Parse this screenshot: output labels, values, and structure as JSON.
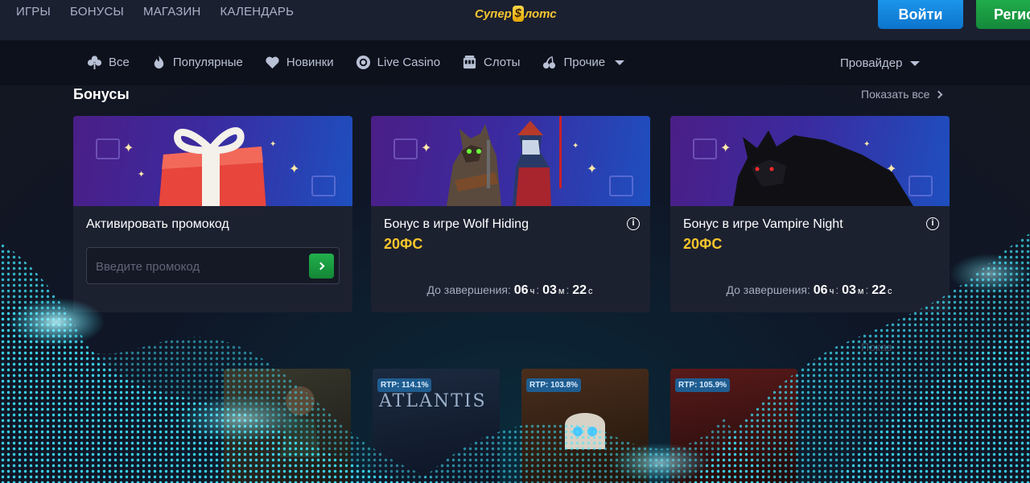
{
  "header": {
    "nav": [
      "ИГРЫ",
      "БОНУСЫ",
      "МАГАЗИН",
      "КАЛЕНДАРЬ"
    ],
    "logo": {
      "left": "Супер",
      "coin": "$",
      "right": "лотс"
    },
    "login_label": "Войти",
    "register_label": "Регис"
  },
  "categories": {
    "items": [
      {
        "label": "Все",
        "icon": "clover-icon"
      },
      {
        "label": "Популярные",
        "icon": "fire-icon"
      },
      {
        "label": "Новинки",
        "icon": "heart-icon"
      },
      {
        "label": "Live Casino",
        "icon": "chip-icon"
      },
      {
        "label": "Слоты",
        "icon": "slot-machine-icon"
      },
      {
        "label": "Прочие",
        "icon": "cherries-icon"
      }
    ],
    "provider_label": "Провайдер"
  },
  "bonuses": {
    "title": "Бонусы",
    "show_all": "Показать все",
    "promo_card": {
      "title": "Активировать промокод",
      "placeholder": "Введите промокод"
    },
    "cards": [
      {
        "title": "Бонус в игре Wolf Hiding",
        "amount": "20ФС",
        "timer_label": "До завершения:",
        "hours": "06",
        "h_unit": "ч",
        "minutes": "03",
        "m_unit": "м",
        "seconds": "22",
        "s_unit": "с"
      },
      {
        "title": "Бонус в игре Vampire Night",
        "amount": "20ФС",
        "timer_label": "До завершения:",
        "hours": "06",
        "h_unit": "ч",
        "minutes": "03",
        "m_unit": "м",
        "seconds": "22",
        "s_unit": "с"
      }
    ]
  },
  "games": {
    "show_all": "Показ",
    "tiles": [
      {
        "rtp": ""
      },
      {
        "rtp": "RTP: 114.1%",
        "name": "ATLANTIS"
      },
      {
        "rtp": "RTP: 103.8%"
      },
      {
        "rtp": "RTP: 105.9%"
      }
    ]
  },
  "colors": {
    "accent_gold": "#f7c52b",
    "login_blue": "#1e9bf0",
    "register_green": "#23b14d",
    "wave_cyan": "#38e6ff"
  }
}
